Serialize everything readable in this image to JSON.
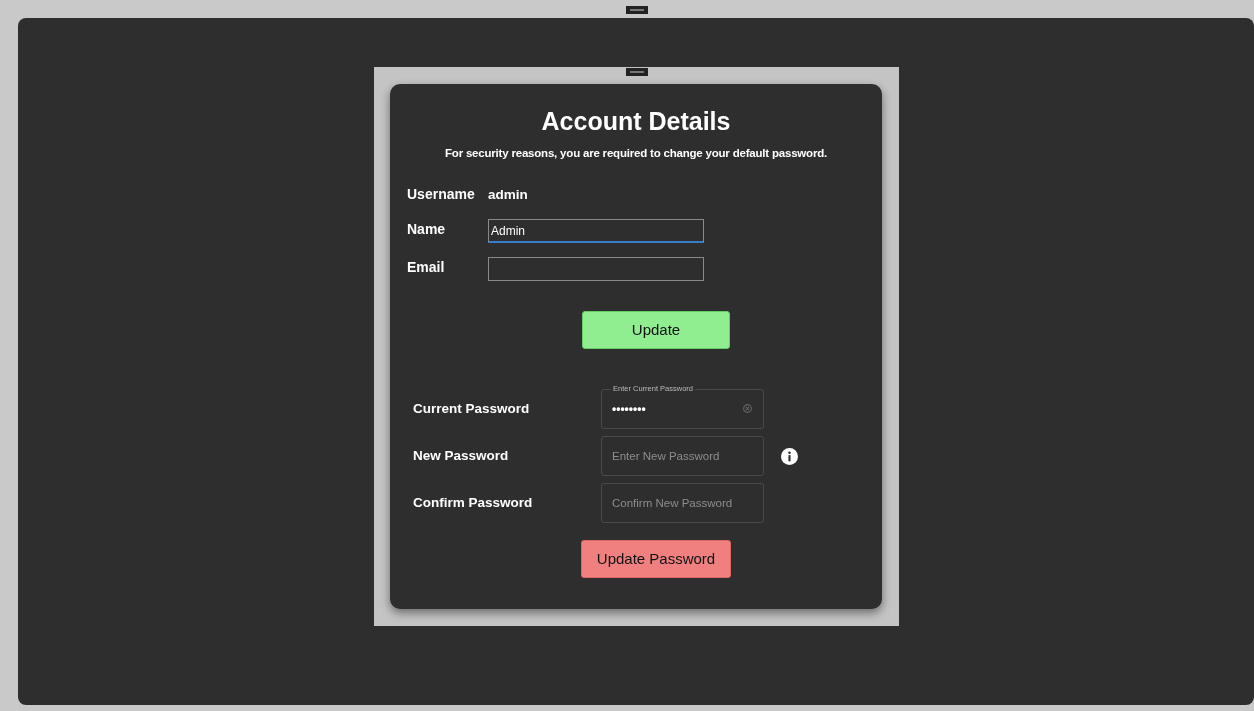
{
  "title": "Account Details",
  "subtitle": "For security reasons, you are required to change your default password.",
  "username": {
    "label": "Username",
    "value": "admin"
  },
  "fields": [
    {
      "label": "Name",
      "value": "Admin",
      "focused": true
    },
    {
      "label": "Email",
      "focused": false
    }
  ],
  "update_button": "Update",
  "password_fields": [
    {
      "label": "Current Password",
      "floating_label": "Enter Current Password",
      "value": "••••••••",
      "clear_icon": true
    },
    {
      "label": "New Password",
      "placeholder": "Enter New Password",
      "info_icon": true
    },
    {
      "label": "Confirm Password",
      "placeholder": "Confirm New Password"
    }
  ],
  "update_password_button": "Update Password"
}
